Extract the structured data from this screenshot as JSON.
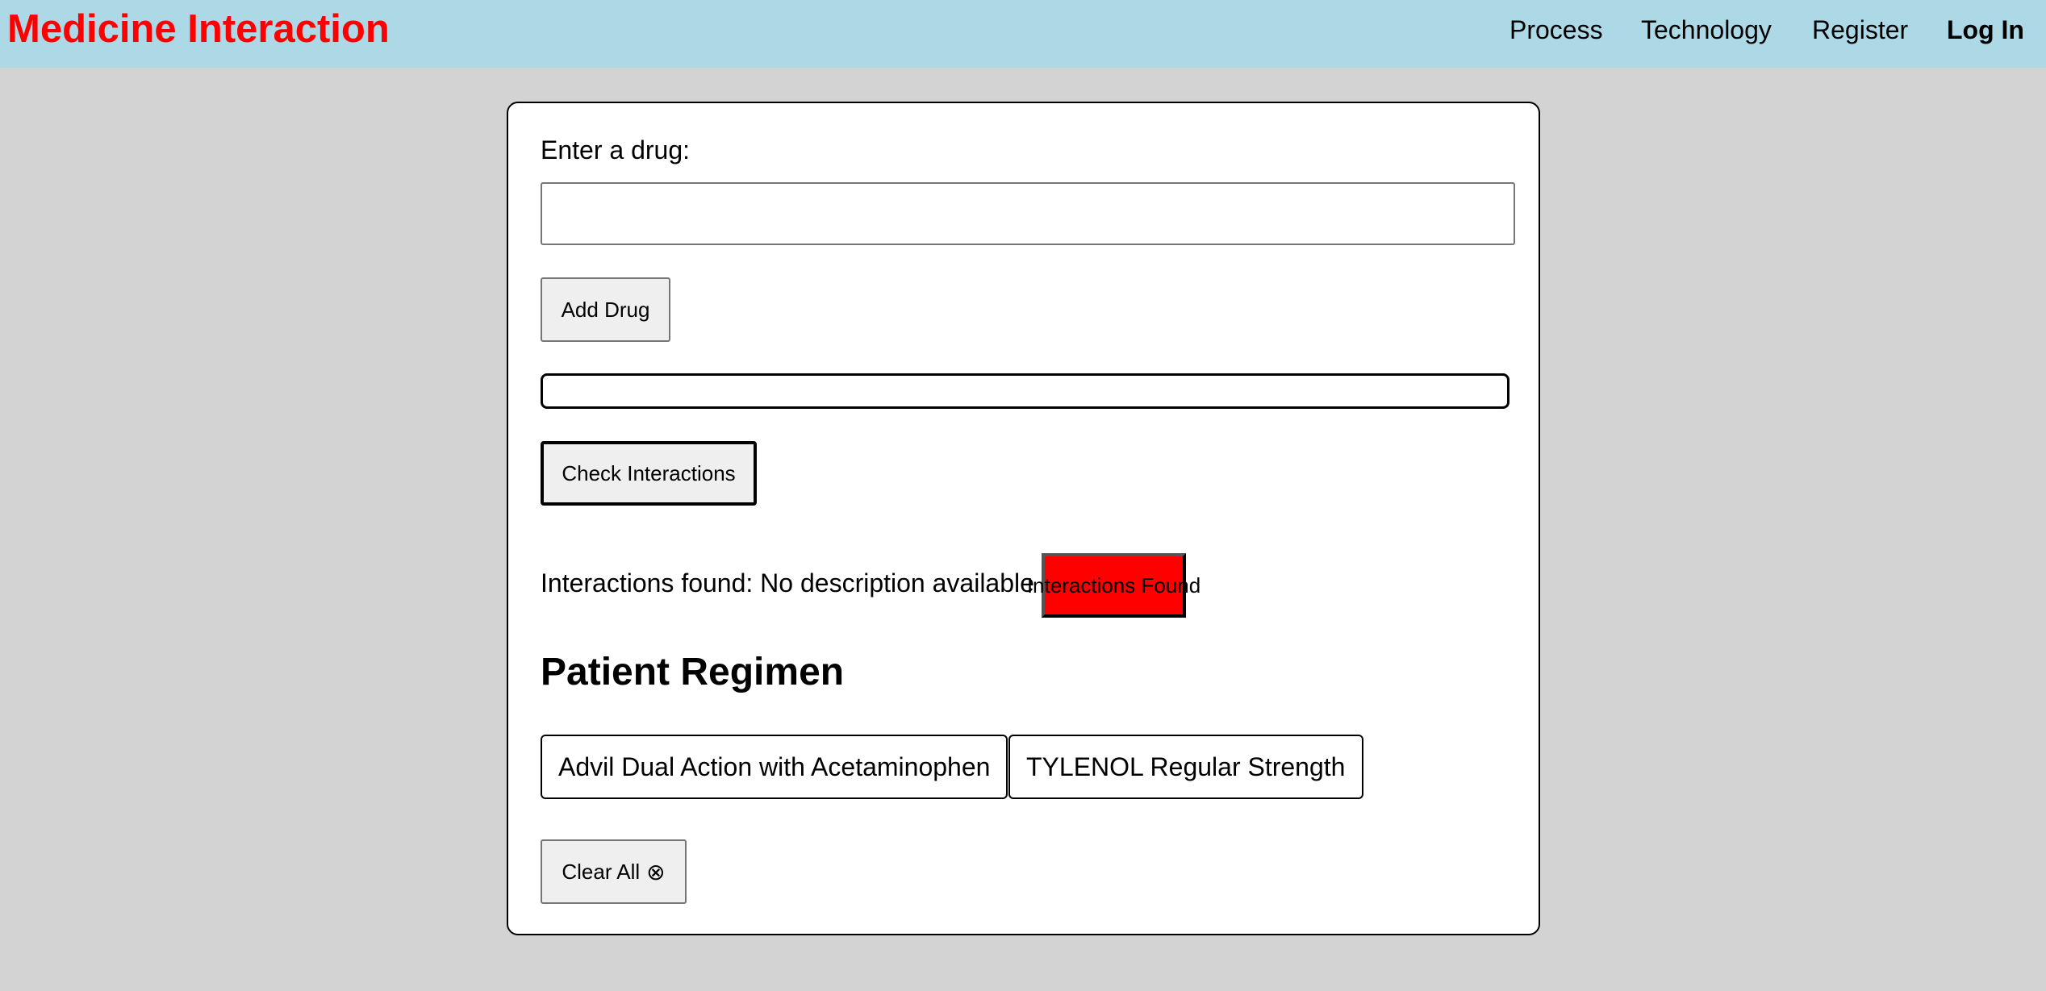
{
  "header": {
    "brand": "Medicine Interaction",
    "nav": [
      "Process",
      "Technology",
      "Register",
      "Log In"
    ]
  },
  "form": {
    "drug_label": "Enter a drug:",
    "drug_input_value": "",
    "add_button": "Add Drug",
    "check_button": "Check Interactions"
  },
  "result": {
    "text": "Interactions found: No description available",
    "badge": "Interactions Found",
    "badge_color": "#ff0000"
  },
  "regimen": {
    "title": "Patient Regimen",
    "drugs": [
      "Advil Dual Action with Acetaminophen",
      "TYLENOL Regular Strength"
    ],
    "clear_button": "Clear All",
    "clear_icon": "⊗"
  },
  "colors": {
    "topbar": "#add8e6",
    "brand": "#ff0000",
    "page_bg": "#d3d3d3"
  }
}
